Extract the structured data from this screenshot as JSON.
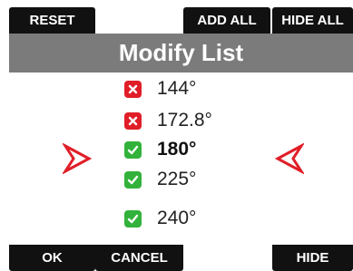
{
  "top_tabs": {
    "reset": "RESET",
    "add_all": "ADD ALL",
    "hide_all": "HIDE ALL"
  },
  "title": "Modify List",
  "list": [
    {
      "label": "144°",
      "checked": false,
      "selected": false
    },
    {
      "label": "172.8°",
      "checked": false,
      "selected": false
    },
    {
      "label": "180°",
      "checked": true,
      "selected": true
    },
    {
      "label": "225°",
      "checked": true,
      "selected": false
    },
    {
      "label": "240°",
      "checked": true,
      "selected": false
    }
  ],
  "bottom_buttons": {
    "ok": "OK",
    "cancel": "CANCEL",
    "hide": "HIDE"
  },
  "colors": {
    "button_bg": "#111111",
    "title_bg": "#7b7b7b",
    "checked": "#33b23b",
    "unchecked": "#e01e28",
    "arrow": "#e01e28"
  },
  "icons": {
    "checked": "check-icon",
    "unchecked": "x-icon",
    "left": "chevron-right-outline-icon",
    "right": "chevron-left-outline-icon"
  }
}
